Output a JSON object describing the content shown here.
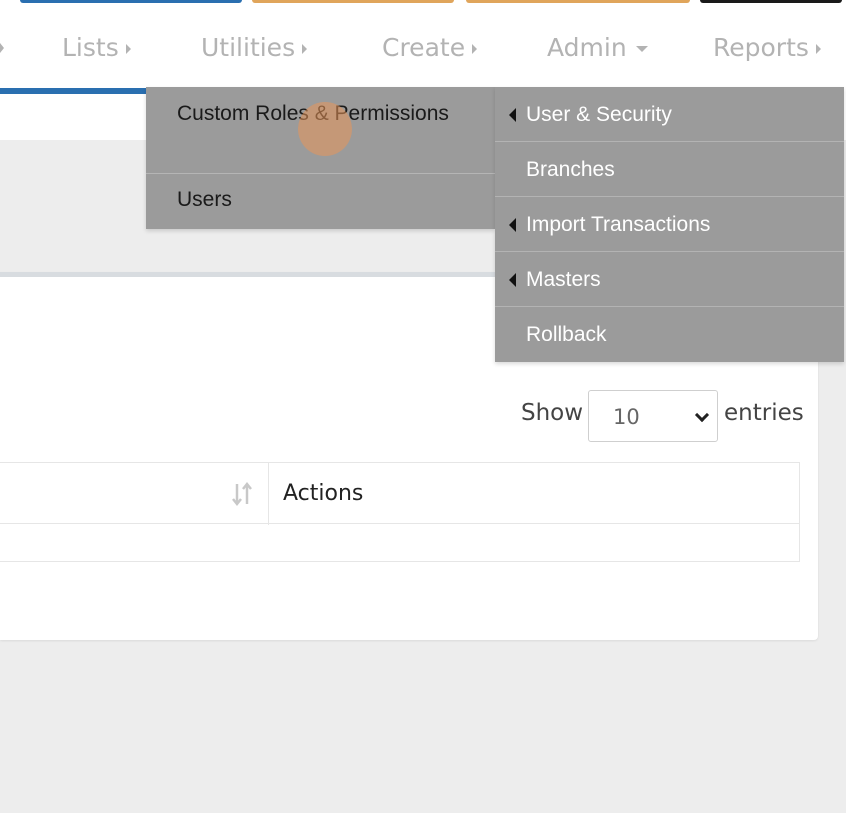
{
  "nav": {
    "items": [
      {
        "label": "Lists"
      },
      {
        "label": "Utilities"
      },
      {
        "label": "Create"
      },
      {
        "label": "Admin"
      },
      {
        "label": "Reports"
      }
    ]
  },
  "admin_menu": {
    "items": [
      {
        "label": "Custom Roles & Permissions"
      },
      {
        "label": "Users"
      }
    ]
  },
  "admin_submenu": {
    "items": [
      {
        "label": "User & Security",
        "has_submenu": true
      },
      {
        "label": "Branches",
        "has_submenu": false
      },
      {
        "label": "Import Transactions",
        "has_submenu": true
      },
      {
        "label": "Masters",
        "has_submenu": true
      },
      {
        "label": "Rollback",
        "has_submenu": false
      }
    ]
  },
  "table_controls": {
    "show_label": "Show",
    "page_size": "10",
    "entries_label": "entries"
  },
  "table": {
    "headers": [
      "Actions"
    ]
  },
  "colors": {
    "menu_bg": "#9b9b9b",
    "nav_text": "#b3b3b3",
    "accent_blue": "#2a6fb0",
    "accent_orange": "#e0a55b"
  }
}
